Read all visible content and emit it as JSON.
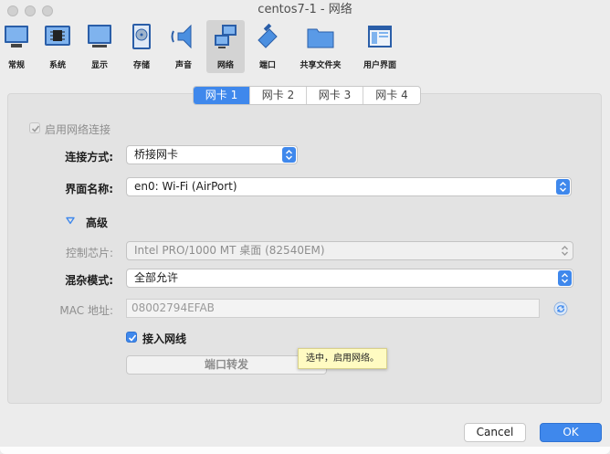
{
  "window": {
    "title": "centos7-1 - 网络"
  },
  "toolbar": {
    "items": [
      {
        "label": "常规",
        "icon": "general-icon"
      },
      {
        "label": "系统",
        "icon": "system-chip-icon"
      },
      {
        "label": "显示",
        "icon": "display-monitor-icon"
      },
      {
        "label": "存储",
        "icon": "storage-disk-icon"
      },
      {
        "label": "声音",
        "icon": "audio-speaker-icon"
      },
      {
        "label": "网络",
        "icon": "network-icon"
      },
      {
        "label": "端口",
        "icon": "ports-icon"
      },
      {
        "label": "共享文件夹",
        "icon": "shared-folder-icon"
      },
      {
        "label": "用户界面",
        "icon": "user-interface-icon"
      }
    ],
    "active": "网络"
  },
  "tabs": [
    "网卡 1",
    "网卡 2",
    "网卡 3",
    "网卡 4"
  ],
  "form": {
    "enable_label": "启用网络连接",
    "attach_label": "连接方式:",
    "attach_value": "桥接网卡",
    "name_label": "界面名称:",
    "name_value": "en0: Wi-Fi (AirPort)",
    "advanced_label": "高级",
    "adapter_label": "控制芯片:",
    "adapter_value": "Intel PRO/1000 MT 桌面 (82540EM)",
    "promisc_label": "混杂模式:",
    "promisc_value": "全部允许",
    "mac_label": "MAC 地址:",
    "mac_value": "08002794EFAB",
    "cable_label": "接入网线",
    "port_forward_label": "端口转发"
  },
  "tooltip": "选中，启用网络。",
  "buttons": {
    "cancel": "Cancel",
    "ok": "OK"
  },
  "colors": {
    "accent": "#3f88ec",
    "tooltip_bg": "#fffbc2"
  }
}
